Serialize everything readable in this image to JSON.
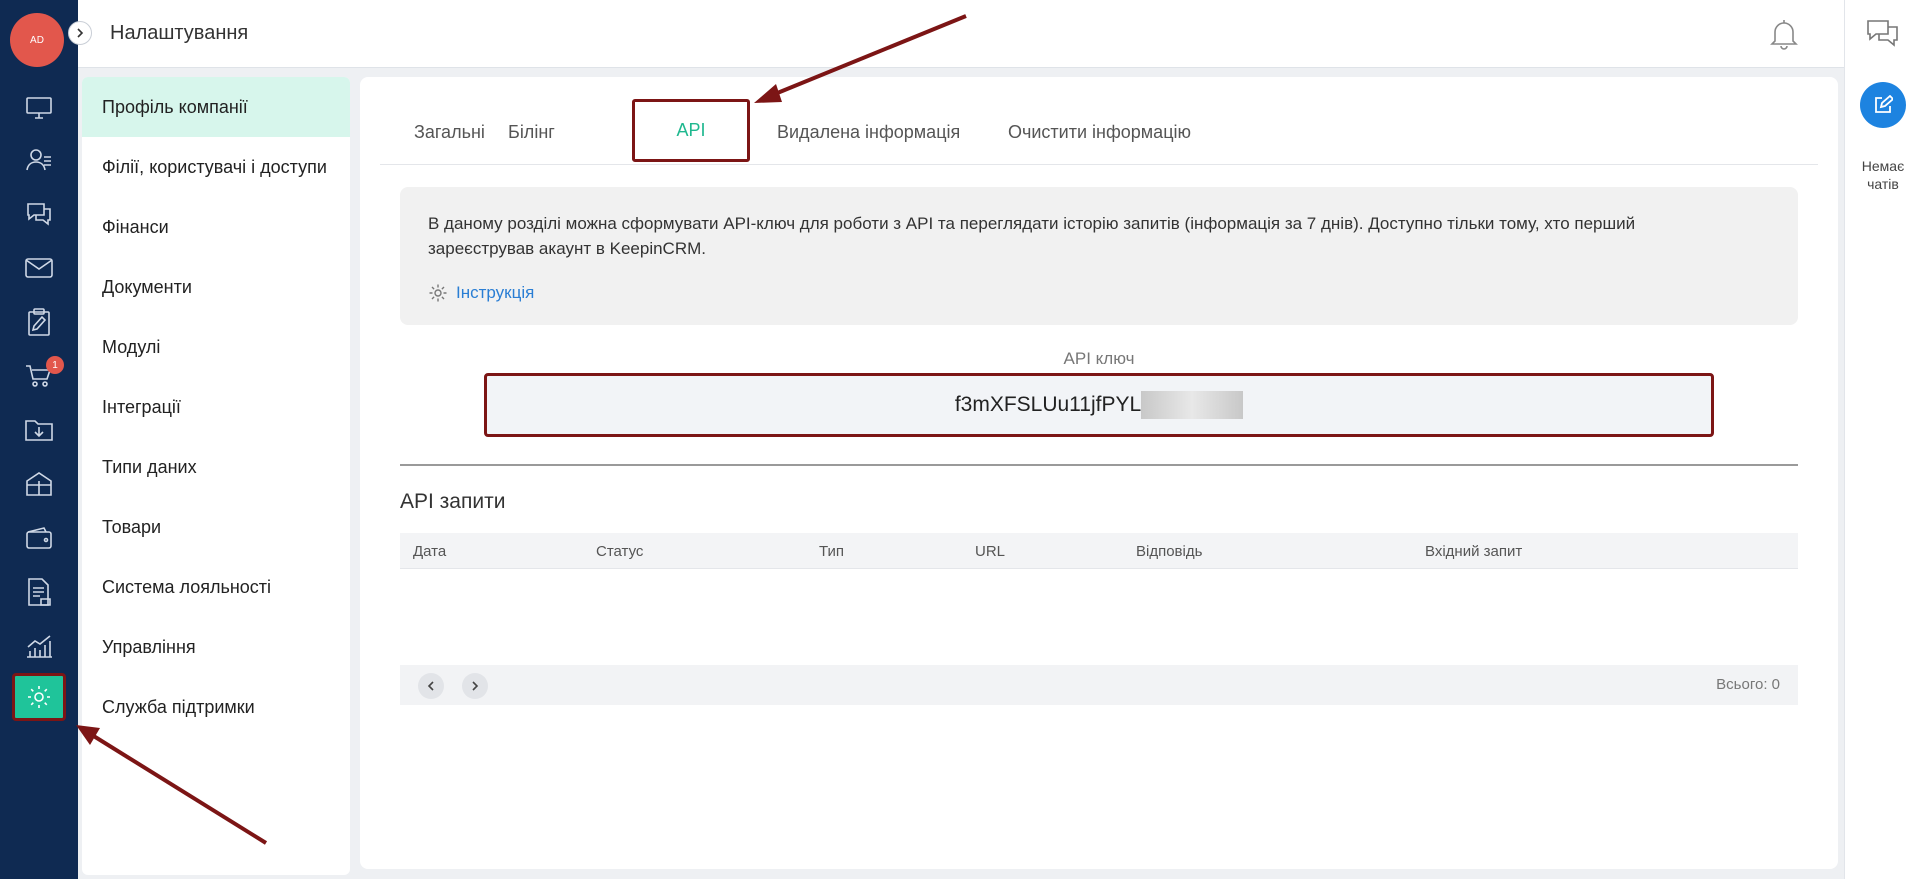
{
  "header": {
    "title": "Налаштування"
  },
  "user": {
    "initials": "AD"
  },
  "rail": {
    "cart_badge": "1"
  },
  "chat": {
    "empty_text_line1": "Немає",
    "empty_text_line2": "чатів"
  },
  "settings_menu": {
    "items": [
      {
        "label": "Профіль компанії",
        "active": true
      },
      {
        "label": "Філії, користувачі і доступи"
      },
      {
        "label": "Фінанси"
      },
      {
        "label": "Документи"
      },
      {
        "label": "Модулі"
      },
      {
        "label": "Інтеграції"
      },
      {
        "label": "Типи даних"
      },
      {
        "label": "Товари"
      },
      {
        "label": "Система лояльності"
      },
      {
        "label": "Управління"
      },
      {
        "label": "Служба підтримки"
      }
    ]
  },
  "tabs": [
    {
      "label": "Загальні"
    },
    {
      "label": "Білінг"
    },
    {
      "label": "API",
      "active": true
    },
    {
      "label": "Видалена інформація"
    },
    {
      "label": "Очистити інформацію"
    }
  ],
  "info": {
    "text_line1": "В даному розділі можна сформувати API-ключ для роботи з API та переглядати історію запитів (інформація за 7 днів). Доступно тільки тому, хто перший",
    "text_line2": "зареєстрував акаунт в KeepinCRM.",
    "link_label": "Інструкція"
  },
  "api_key": {
    "label": "API ключ",
    "value_visible": "f3mXFSLUu11jfPYL"
  },
  "requests": {
    "title": "API запити",
    "columns": [
      "Дата",
      "Статус",
      "Тип",
      "URL",
      "Відповідь",
      "Вхідний запит"
    ],
    "rows": [],
    "total_label": "Всього: 0"
  },
  "colors": {
    "accent": "#1fc49a",
    "rail_bg": "#0f2a52",
    "highlight": "#7c1515",
    "link": "#2a7ed4"
  }
}
